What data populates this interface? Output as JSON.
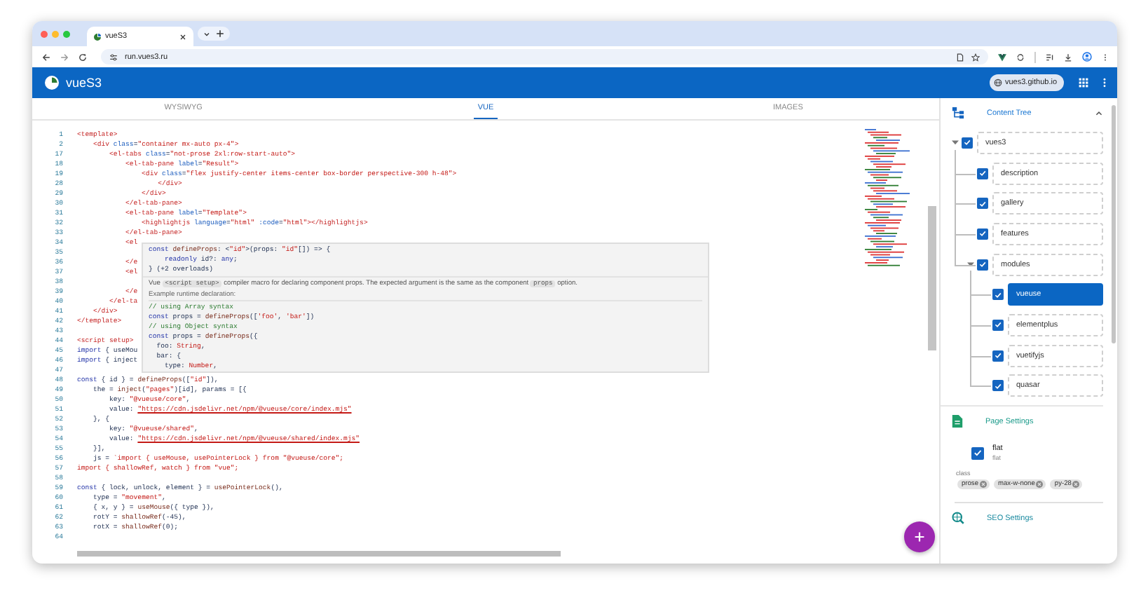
{
  "browser": {
    "tab_title": "vueS3",
    "url": "run.vues3.ru"
  },
  "app_bar": {
    "title": "vueS3",
    "site_button": "vues3.github.io"
  },
  "editor_tabs": [
    {
      "label": "WYSIWYG",
      "selected": false
    },
    {
      "label": "VUE",
      "selected": true
    },
    {
      "label": "IMAGES",
      "selected": false
    }
  ],
  "code_lines": [
    {
      "num": "1",
      "tokens": [
        {
          "kind": "tag",
          "text": "<template>"
        }
      ]
    },
    {
      "num": "2",
      "tokens": [
        {
          "kind": "tag",
          "text": "    <div "
        },
        {
          "kind": "attr",
          "text": "class"
        },
        {
          "kind": "plain",
          "text": "="
        },
        {
          "kind": "str",
          "text": "\"container mx-auto px-4\""
        },
        {
          "kind": "tag",
          "text": ">"
        }
      ]
    },
    {
      "num": "17",
      "tokens": [
        {
          "kind": "tag",
          "text": "        <el-tabs "
        },
        {
          "kind": "attr",
          "text": "class"
        },
        {
          "kind": "plain",
          "text": "="
        },
        {
          "kind": "str",
          "text": "\"not-prose 2xl:row-start-auto\""
        },
        {
          "kind": "tag",
          "text": ">"
        }
      ]
    },
    {
      "num": "18",
      "tokens": [
        {
          "kind": "tag",
          "text": "            <el-tab-pane "
        },
        {
          "kind": "attr",
          "text": "label"
        },
        {
          "kind": "plain",
          "text": "="
        },
        {
          "kind": "str",
          "text": "\"Result\""
        },
        {
          "kind": "tag",
          "text": ">"
        }
      ]
    },
    {
      "num": "19",
      "tokens": [
        {
          "kind": "tag",
          "text": "                <div "
        },
        {
          "kind": "attr",
          "text": "class"
        },
        {
          "kind": "plain",
          "text": "="
        },
        {
          "kind": "str",
          "text": "\"flex justify-center items-center box-border perspective-300 h-48\""
        },
        {
          "kind": "tag",
          "text": ">"
        }
      ]
    },
    {
      "num": "28",
      "tokens": [
        {
          "kind": "tag",
          "text": "                    </div>"
        }
      ]
    },
    {
      "num": "29",
      "tokens": [
        {
          "kind": "tag",
          "text": "                </div>"
        }
      ]
    },
    {
      "num": "30",
      "tokens": [
        {
          "kind": "tag",
          "text": "            </el-tab-pane>"
        }
      ]
    },
    {
      "num": "31",
      "tokens": [
        {
          "kind": "tag",
          "text": "            <el-tab-pane "
        },
        {
          "kind": "attr",
          "text": "label"
        },
        {
          "kind": "plain",
          "text": "="
        },
        {
          "kind": "str",
          "text": "\"Template\""
        },
        {
          "kind": "tag",
          "text": ">"
        }
      ]
    },
    {
      "num": "32",
      "tokens": [
        {
          "kind": "tag",
          "text": "                <highlightjs "
        },
        {
          "kind": "attr",
          "text": "language"
        },
        {
          "kind": "plain",
          "text": "="
        },
        {
          "kind": "str",
          "text": "\"html\" "
        },
        {
          "kind": "attr",
          "text": ":code"
        },
        {
          "kind": "plain",
          "text": "="
        },
        {
          "kind": "str",
          "text": "\"html\""
        },
        {
          "kind": "tag",
          "text": "></highlightjs>"
        }
      ]
    },
    {
      "num": "33",
      "tokens": [
        {
          "kind": "tag",
          "text": "            </el-tab-pane>"
        }
      ]
    },
    {
      "num": "34",
      "tokens": [
        {
          "kind": "tag",
          "text": "            <el"
        }
      ]
    },
    {
      "num": "35"
    },
    {
      "num": "36",
      "tokens": [
        {
          "kind": "tag",
          "text": "            </e"
        }
      ]
    },
    {
      "num": "37",
      "tokens": [
        {
          "kind": "tag",
          "text": "            <el"
        }
      ]
    },
    {
      "num": "38"
    },
    {
      "num": "39",
      "tokens": [
        {
          "kind": "tag",
          "text": "            </e"
        }
      ]
    },
    {
      "num": "40",
      "tokens": [
        {
          "kind": "tag",
          "text": "        </el-ta"
        }
      ]
    },
    {
      "num": "41",
      "tokens": [
        {
          "kind": "tag",
          "text": "    </div>"
        }
      ]
    },
    {
      "num": "42",
      "tokens": [
        {
          "kind": "tag",
          "text": "</template>"
        }
      ]
    },
    {
      "num": "43"
    },
    {
      "num": "44",
      "tokens": [
        {
          "kind": "tag",
          "text": "<script setup>"
        }
      ]
    },
    {
      "num": "45",
      "tokens": [
        {
          "kind": "kw",
          "text": "import"
        },
        {
          "kind": "plain",
          "text": " { useMou"
        }
      ]
    },
    {
      "num": "46",
      "tokens": [
        {
          "kind": "kw",
          "text": "import"
        },
        {
          "kind": "plain",
          "text": " { inject"
        }
      ]
    },
    {
      "num": "47"
    },
    {
      "num": "48",
      "tokens": [
        {
          "kind": "kw",
          "text": "const"
        },
        {
          "kind": "plain",
          "text": " { id } = "
        },
        {
          "kind": "fn",
          "text": "defineProps"
        },
        {
          "kind": "plain",
          "text": "(["
        },
        {
          "kind": "str",
          "text": "\"id\""
        },
        {
          "kind": "plain",
          "text": "]),"
        }
      ]
    },
    {
      "num": "49",
      "tokens": [
        {
          "kind": "plain",
          "text": "    the = "
        },
        {
          "kind": "fn",
          "text": "inject"
        },
        {
          "kind": "plain",
          "text": "("
        },
        {
          "kind": "str",
          "text": "\"pages\""
        },
        {
          "kind": "plain",
          "text": ")[id], params = [{"
        }
      ]
    },
    {
      "num": "50",
      "tokens": [
        {
          "kind": "plain",
          "text": "        key: "
        },
        {
          "kind": "str",
          "text": "\"@vueuse/core\""
        },
        {
          "kind": "plain",
          "text": ","
        }
      ]
    },
    {
      "num": "51",
      "tokens": [
        {
          "kind": "plain",
          "text": "        value: "
        },
        {
          "kind": "link",
          "text": "\"https://cdn.jsdelivr.net/npm/@vueuse/core/index.mjs\""
        }
      ]
    },
    {
      "num": "52",
      "tokens": [
        {
          "kind": "plain",
          "text": "    }, {"
        }
      ]
    },
    {
      "num": "53",
      "tokens": [
        {
          "kind": "plain",
          "text": "        key: "
        },
        {
          "kind": "str",
          "text": "\"@vueuse/shared\""
        },
        {
          "kind": "plain",
          "text": ","
        }
      ]
    },
    {
      "num": "54",
      "tokens": [
        {
          "kind": "plain",
          "text": "        value: "
        },
        {
          "kind": "link",
          "text": "\"https://cdn.jsdelivr.net/npm/@vueuse/shared/index.mjs\""
        }
      ]
    },
    {
      "num": "55",
      "tokens": [
        {
          "kind": "plain",
          "text": "    }],"
        }
      ]
    },
    {
      "num": "56",
      "tokens": [
        {
          "kind": "plain",
          "text": "    js = "
        },
        {
          "kind": "str",
          "text": "`import { useMouse, usePointerLock } from \"@vueuse/core\";"
        }
      ]
    },
    {
      "num": "57",
      "tokens": [
        {
          "kind": "str",
          "text": "import { shallowRef, watch } from \"vue\";"
        }
      ]
    },
    {
      "num": "58"
    },
    {
      "num": "59",
      "tokens": [
        {
          "kind": "kw",
          "text": "const"
        },
        {
          "kind": "plain",
          "text": " { lock, unlock, element } = "
        },
        {
          "kind": "fn",
          "text": "usePointerLock"
        },
        {
          "kind": "plain",
          "text": "(),"
        }
      ]
    },
    {
      "num": "60",
      "tokens": [
        {
          "kind": "plain",
          "text": "    type = "
        },
        {
          "kind": "str",
          "text": "\"movement\""
        },
        {
          "kind": "plain",
          "text": ","
        }
      ]
    },
    {
      "num": "61",
      "tokens": [
        {
          "kind": "plain",
          "text": "    { x, y } = "
        },
        {
          "kind": "fn",
          "text": "useMouse"
        },
        {
          "kind": "plain",
          "text": "({ type }),"
        }
      ]
    },
    {
      "num": "62",
      "tokens": [
        {
          "kind": "plain",
          "text": "    rotY = "
        },
        {
          "kind": "fn",
          "text": "shallowRef"
        },
        {
          "kind": "plain",
          "text": "(-45),"
        }
      ]
    },
    {
      "num": "63",
      "tokens": [
        {
          "kind": "plain",
          "text": "    rotX = "
        },
        {
          "kind": "fn",
          "text": "shallowRef"
        },
        {
          "kind": "plain",
          "text": "(0);"
        }
      ]
    },
    {
      "num": "64"
    }
  ],
  "hover_tooltip": {
    "signature": [
      {
        "tokens": [
          {
            "kind": "kw",
            "text": "const "
          },
          {
            "kind": "fn",
            "text": "defineProps"
          },
          {
            "kind": "plain",
            "text": ": <"
          },
          {
            "kind": "str",
            "text": "\"id\""
          },
          {
            "kind": "plain",
            "text": ">(props: "
          },
          {
            "kind": "str",
            "text": "\"id\""
          },
          {
            "kind": "plain",
            "text": "[]) => {"
          }
        ]
      },
      {
        "tokens": [
          {
            "kind": "kw",
            "text": "    readonly"
          },
          {
            "kind": "plain",
            "text": " id?: "
          },
          {
            "kind": "kw",
            "text": "any"
          },
          {
            "kind": "plain",
            "text": ";"
          }
        ]
      },
      {
        "tokens": [
          {
            "kind": "plain",
            "text": "} (+2 overloads)"
          }
        ]
      }
    ],
    "description": [
      {
        "kind": "text",
        "text": "Vue "
      },
      {
        "kind": "code",
        "text": "<script setup>"
      },
      {
        "kind": "text",
        "text": " compiler macro for declaring component props. The expected argument is the same as the component "
      },
      {
        "kind": "code",
        "text": "props"
      },
      {
        "kind": "text",
        "text": " option."
      }
    ],
    "example_heading": "Example runtime declaration:",
    "example": [
      {
        "tokens": [
          {
            "kind": "cmt",
            "text": "// using Array syntax"
          }
        ]
      },
      {
        "tokens": [
          {
            "kind": "kw",
            "text": "const"
          },
          {
            "kind": "plain",
            "text": " props = "
          },
          {
            "kind": "fn",
            "text": "defineProps"
          },
          {
            "kind": "plain",
            "text": "(["
          },
          {
            "kind": "str",
            "text": "'foo'"
          },
          {
            "kind": "plain",
            "text": ", "
          },
          {
            "kind": "str",
            "text": "'bar'"
          },
          {
            "kind": "plain",
            "text": "])"
          }
        ]
      },
      {
        "tokens": [
          {
            "kind": "cmt",
            "text": "// using Object syntax"
          }
        ]
      },
      {
        "tokens": [
          {
            "kind": "kw",
            "text": "const"
          },
          {
            "kind": "plain",
            "text": " props = "
          },
          {
            "kind": "fn",
            "text": "defineProps"
          },
          {
            "kind": "plain",
            "text": "({"
          }
        ]
      },
      {
        "tokens": [
          {
            "kind": "plain",
            "text": "  foo: "
          },
          {
            "kind": "type",
            "text": "String"
          },
          {
            "kind": "plain",
            "text": ","
          }
        ]
      },
      {
        "tokens": [
          {
            "kind": "plain",
            "text": "  bar: {"
          }
        ]
      },
      {
        "tokens": [
          {
            "kind": "plain",
            "text": "    type: "
          },
          {
            "kind": "type",
            "text": "Number"
          },
          {
            "kind": "plain",
            "text": ","
          }
        ]
      }
    ]
  },
  "content_tree": {
    "title": "Content Tree",
    "expanded": true,
    "items": [
      {
        "label": "vues3",
        "checked": true,
        "selected": false,
        "expanded": true,
        "children": [
          {
            "label": "description",
            "checked": true,
            "selected": false
          },
          {
            "label": "gallery",
            "checked": true,
            "selected": false
          },
          {
            "label": "features",
            "checked": true,
            "selected": false
          },
          {
            "label": "modules",
            "checked": true,
            "selected": false,
            "expanded": true,
            "children": [
              {
                "label": "vueuse",
                "checked": true,
                "selected": true
              },
              {
                "label": "elementplus",
                "checked": true,
                "selected": false
              },
              {
                "label": "vuetifyjs",
                "checked": true,
                "selected": false
              },
              {
                "label": "quasar",
                "checked": true,
                "selected": false
              }
            ]
          }
        ]
      }
    ]
  },
  "page_settings": {
    "title": "Page Settings",
    "flat": {
      "label": "flat",
      "hint": "flat",
      "checked": true
    },
    "class_label": "class",
    "chips": [
      "prose",
      "max-w-none",
      "py-28"
    ]
  },
  "seo_settings": {
    "title": "SEO Settings"
  }
}
